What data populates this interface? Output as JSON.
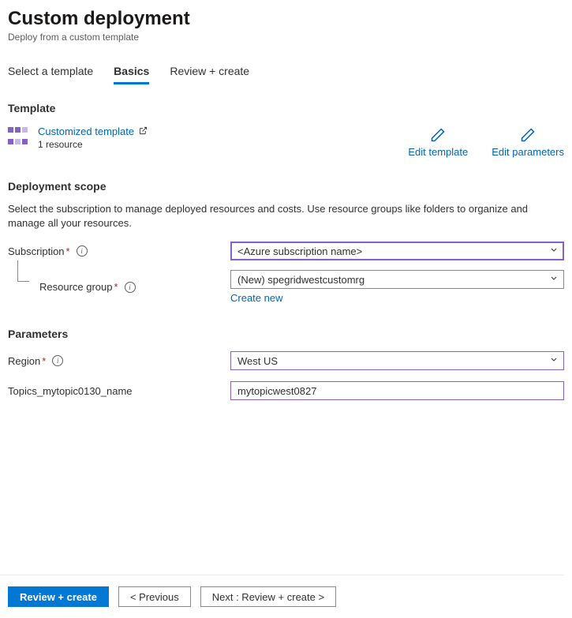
{
  "page": {
    "title": "Custom deployment",
    "subtitle": "Deploy from a custom template"
  },
  "tabs": {
    "t0": "Select a template",
    "t1": "Basics",
    "t2": "Review + create"
  },
  "template": {
    "heading": "Template",
    "link_label": "Customized template",
    "resource_count": "1 resource",
    "edit_template": "Edit template",
    "edit_parameters": "Edit parameters"
  },
  "scope": {
    "heading": "Deployment scope",
    "description": "Select the subscription to manage deployed resources and costs. Use resource groups like folders to organize and manage all your resources.",
    "subscription_label": "Subscription",
    "subscription_value": "<Azure subscription name>",
    "rg_label": "Resource group",
    "rg_value": "(New) spegridwestcustomrg",
    "create_new": "Create new"
  },
  "params": {
    "heading": "Parameters",
    "region_label": "Region",
    "region_value": "West US",
    "topic_label": "Topics_mytopic0130_name",
    "topic_value": "mytopicwest0827"
  },
  "footer": {
    "review": "Review + create",
    "previous": "< Previous",
    "next": "Next : Review + create >"
  }
}
